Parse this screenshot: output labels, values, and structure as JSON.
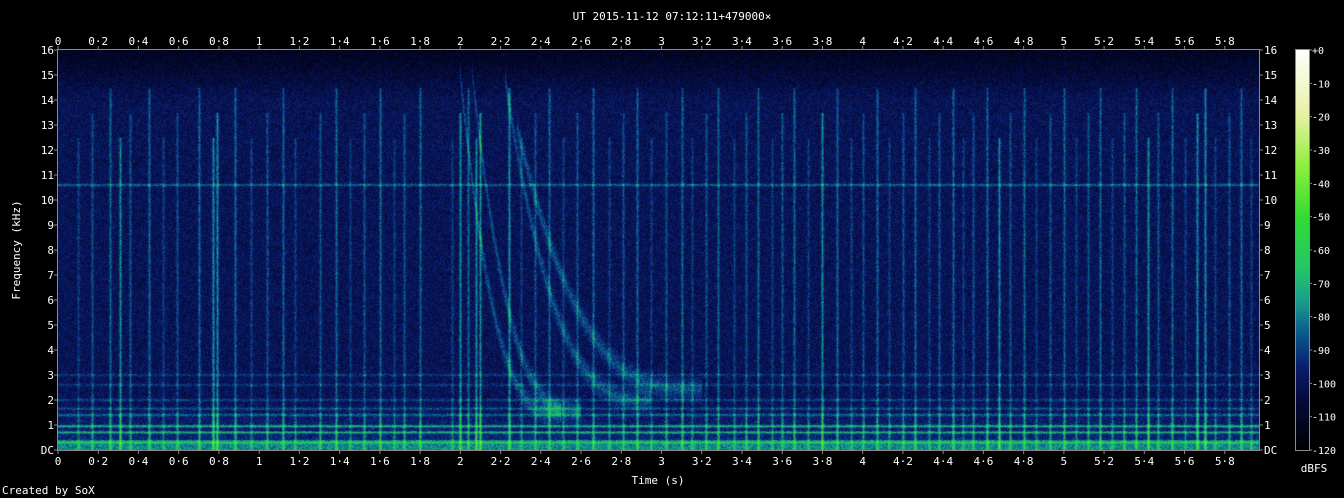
{
  "chart_data": {
    "type": "heatmap",
    "title": "UT 2015-11-12 07:12:11+479000×",
    "xlabel": "Time (s)",
    "ylabel": "Frequency (kHz)",
    "footer": "Created by SoX",
    "xlim": [
      0,
      5.97
    ],
    "ylim": [
      0,
      16
    ],
    "x_ticks": [
      "0",
      "0·2",
      "0·4",
      "0·6",
      "0·8",
      "1",
      "1·2",
      "1·4",
      "1·6",
      "1·8",
      "2",
      "2·2",
      "2·4",
      "2·6",
      "2·8",
      "3",
      "3·2",
      "3·4",
      "3·6",
      "3·8",
      "4",
      "4·2",
      "4·4",
      "4·6",
      "4·8",
      "5",
      "5·2",
      "5·4",
      "5·6",
      "5·8"
    ],
    "x_tick_values": [
      0,
      0.2,
      0.4,
      0.6,
      0.8,
      1,
      1.2,
      1.4,
      1.6,
      1.8,
      2,
      2.2,
      2.4,
      2.6,
      2.8,
      3,
      3.2,
      3.4,
      3.6,
      3.8,
      4,
      4.2,
      4.4,
      4.6,
      4.8,
      5,
      5.2,
      5.4,
      5.6,
      5.8
    ],
    "y_ticks": [
      "DC",
      "1",
      "2",
      "3",
      "4",
      "5",
      "6",
      "7",
      "8",
      "9",
      "10",
      "11",
      "12",
      "13",
      "14",
      "15",
      "16"
    ],
    "y_tick_values": [
      0,
      1,
      2,
      3,
      4,
      5,
      6,
      7,
      8,
      9,
      10,
      11,
      12,
      13,
      14,
      15,
      16
    ],
    "colorbar": {
      "label": "dBFS",
      "ticks": [
        "+0",
        "-10",
        "-20",
        "-30",
        "-40",
        "-50",
        "-60",
        "-70",
        "-80",
        "-90",
        "-100",
        "-110",
        "-120"
      ],
      "tick_values": [
        0,
        -10,
        -20,
        -30,
        -40,
        -50,
        -60,
        -70,
        -80,
        -90,
        -100,
        -110,
        -120
      ],
      "range": [
        -120,
        0
      ],
      "stops": [
        {
          "value": -120,
          "color": "#000000"
        },
        {
          "value": -105,
          "color": "#050a3c"
        },
        {
          "value": -95,
          "color": "#0a1e6e"
        },
        {
          "value": -85,
          "color": "#0a5a8c"
        },
        {
          "value": -75,
          "color": "#19a08c"
        },
        {
          "value": -65,
          "color": "#23c864"
        },
        {
          "value": -50,
          "color": "#32dc32"
        },
        {
          "value": -35,
          "color": "#8cf03c"
        },
        {
          "value": -20,
          "color": "#e6f0a0"
        },
        {
          "value": 0,
          "color": "#ffffff"
        }
      ]
    },
    "features": {
      "background_level_dbfs": -100,
      "tone_lines": [
        {
          "freq_khz": 10.6,
          "level_dbfs": -82
        },
        {
          "freq_khz": 0.95,
          "level_dbfs": -70
        },
        {
          "freq_khz": 0.7,
          "level_dbfs": -72
        },
        {
          "freq_khz": 1.4,
          "level_dbfs": -82
        },
        {
          "freq_khz": 1.65,
          "level_dbfs": -86
        },
        {
          "freq_khz": 2.0,
          "level_dbfs": -88
        },
        {
          "freq_khz": 2.6,
          "level_dbfs": -90
        },
        {
          "freq_khz": 3.0,
          "level_dbfs": -90
        },
        {
          "freq_khz": 0.3,
          "level_dbfs": -78
        }
      ],
      "sferics_s": [
        0.1,
        0.17,
        0.26,
        0.31,
        0.36,
        0.45,
        0.52,
        0.59,
        0.7,
        0.77,
        0.79,
        0.88,
        0.96,
        1.04,
        1.12,
        1.18,
        1.3,
        1.38,
        1.45,
        1.52,
        1.6,
        1.67,
        1.72,
        1.8,
        1.96,
        2.0,
        2.04,
        2.08,
        2.1,
        2.24,
        2.3,
        2.37,
        2.44,
        2.51,
        2.58,
        2.66,
        2.74,
        2.81,
        2.88,
        2.95,
        3.02,
        3.1,
        3.15,
        3.22,
        3.28,
        3.36,
        3.42,
        3.48,
        3.55,
        3.6,
        3.66,
        3.73,
        3.8,
        3.87,
        3.94,
        4.0,
        4.07,
        4.13,
        4.2,
        4.26,
        4.33,
        4.38,
        4.45,
        4.5,
        4.55,
        4.62,
        4.68,
        4.73,
        4.8,
        4.86,
        4.93,
        5.0,
        5.06,
        5.12,
        5.18,
        5.24,
        5.3,
        5.36,
        5.42,
        5.47,
        5.54,
        5.6,
        5.66,
        5.7,
        5.75,
        5.82,
        5.88,
        5.93
      ],
      "strong_sferics_s": [
        0.3,
        0.78,
        2.0,
        2.07,
        2.1,
        2.24,
        3.38,
        3.79,
        4.67,
        5.43,
        5.66,
        5.7
      ],
      "whistlers": [
        {
          "start_s": 2.0,
          "end_s": 2.5,
          "f_high_khz": 15,
          "f_low_khz": 1.5
        },
        {
          "start_s": 2.06,
          "end_s": 2.6,
          "f_high_khz": 15,
          "f_low_khz": 1.6
        },
        {
          "start_s": 2.22,
          "end_s": 2.95,
          "f_high_khz": 15,
          "f_low_khz": 2.0
        },
        {
          "start_s": 2.28,
          "end_s": 3.2,
          "f_high_khz": 13,
          "f_low_khz": 2.4
        }
      ]
    }
  }
}
